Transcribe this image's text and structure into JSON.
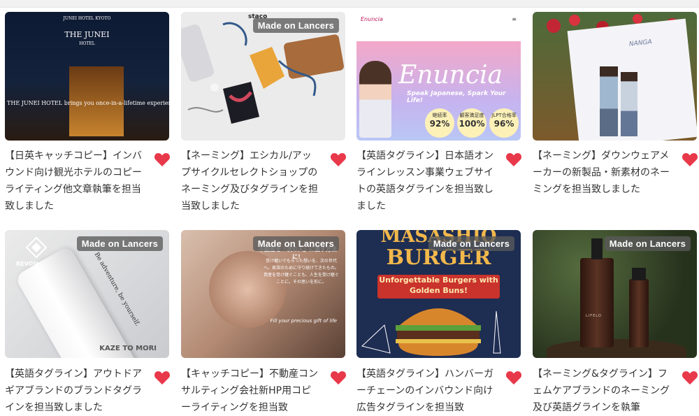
{
  "badge_label": "Made on Lancers",
  "colors": {
    "heart": "#e8394a",
    "title_text": "#333333"
  },
  "cards": [
    {
      "title": "【日英キャッチコピー】インバウンド向け観光ホテルのコピーライティング他文章執筆を担当致しました",
      "show_badge": false,
      "thumb": {
        "logo_top": "JUNEI HOTEL KYOTO",
        "logo_name": "THE JUNEI",
        "logo_sub": "HOTEL",
        "tagline": "THE JUNEI HOTEL brings you once-in-a-lifetime experiences"
      }
    },
    {
      "title": "【ネーミング】エシカル/アップサイクルセレクトショップのネーミング及びタグラインを担当致しました",
      "show_badge": true,
      "thumb": {
        "label": "staco"
      }
    },
    {
      "title": "【英語タグライン】日本語オンラインレッスン事業ウェブサイトの英語タグラインを担当致しました",
      "show_badge": false,
      "thumb": {
        "brand": "Enuncia",
        "small_brand": "Enuncia",
        "subtitle": "Speak Japanese, Spark Your Life!",
        "stats": [
          {
            "label": "継続率",
            "value": "92%"
          },
          {
            "label": "顧客満足度",
            "value": "100%"
          },
          {
            "label": "JLPT合格率",
            "value": "96%"
          }
        ]
      }
    },
    {
      "title": "【ネーミング】ダウンウェアメーカーの新製品・新素材のネーミングを担当致しました",
      "show_badge": false,
      "thumb": {
        "brand": "NANGA"
      }
    },
    {
      "title": "【英語タグライン】アウトドアギアブランドのブランドタグラインを担当致しました",
      "show_badge": true,
      "thumb": {
        "brand": "REVOMAX",
        "bottle_text": "Be adventure, be yourself.",
        "footer": "KAZE TO MORI"
      }
    },
    {
      "title": "【キャッチコピー】不動産コンサルティング会社新HP用コピーライティングを担当致",
      "show_badge": true,
      "thumb": {
        "headline": "不動産を「次の人」に渡す方法に！",
        "body": "受け継いでもらった想いを、次の世代へ。家族のために守り続けてきたもの。資産を受け継ぐことも、人生を受け継ぐことに。その思いを形に。",
        "english": "Fill your precious gift of life"
      }
    },
    {
      "title": "【英語タグライン】ハンバーガーチェーンのインバウンド向け広告タグラインを担当致",
      "show_badge": true,
      "thumb": {
        "brand_line1": "MASASHIO",
        "brand_line2": "BURGER",
        "slogan": "Unforgettable Burgers with Golden Buns!"
      }
    },
    {
      "title": "【ネーミング&タグライン】フェムケアブランドのネーミング及び英語グラインを執筆",
      "show_badge": true,
      "thumb": {
        "product": "LIFELO"
      }
    }
  ]
}
